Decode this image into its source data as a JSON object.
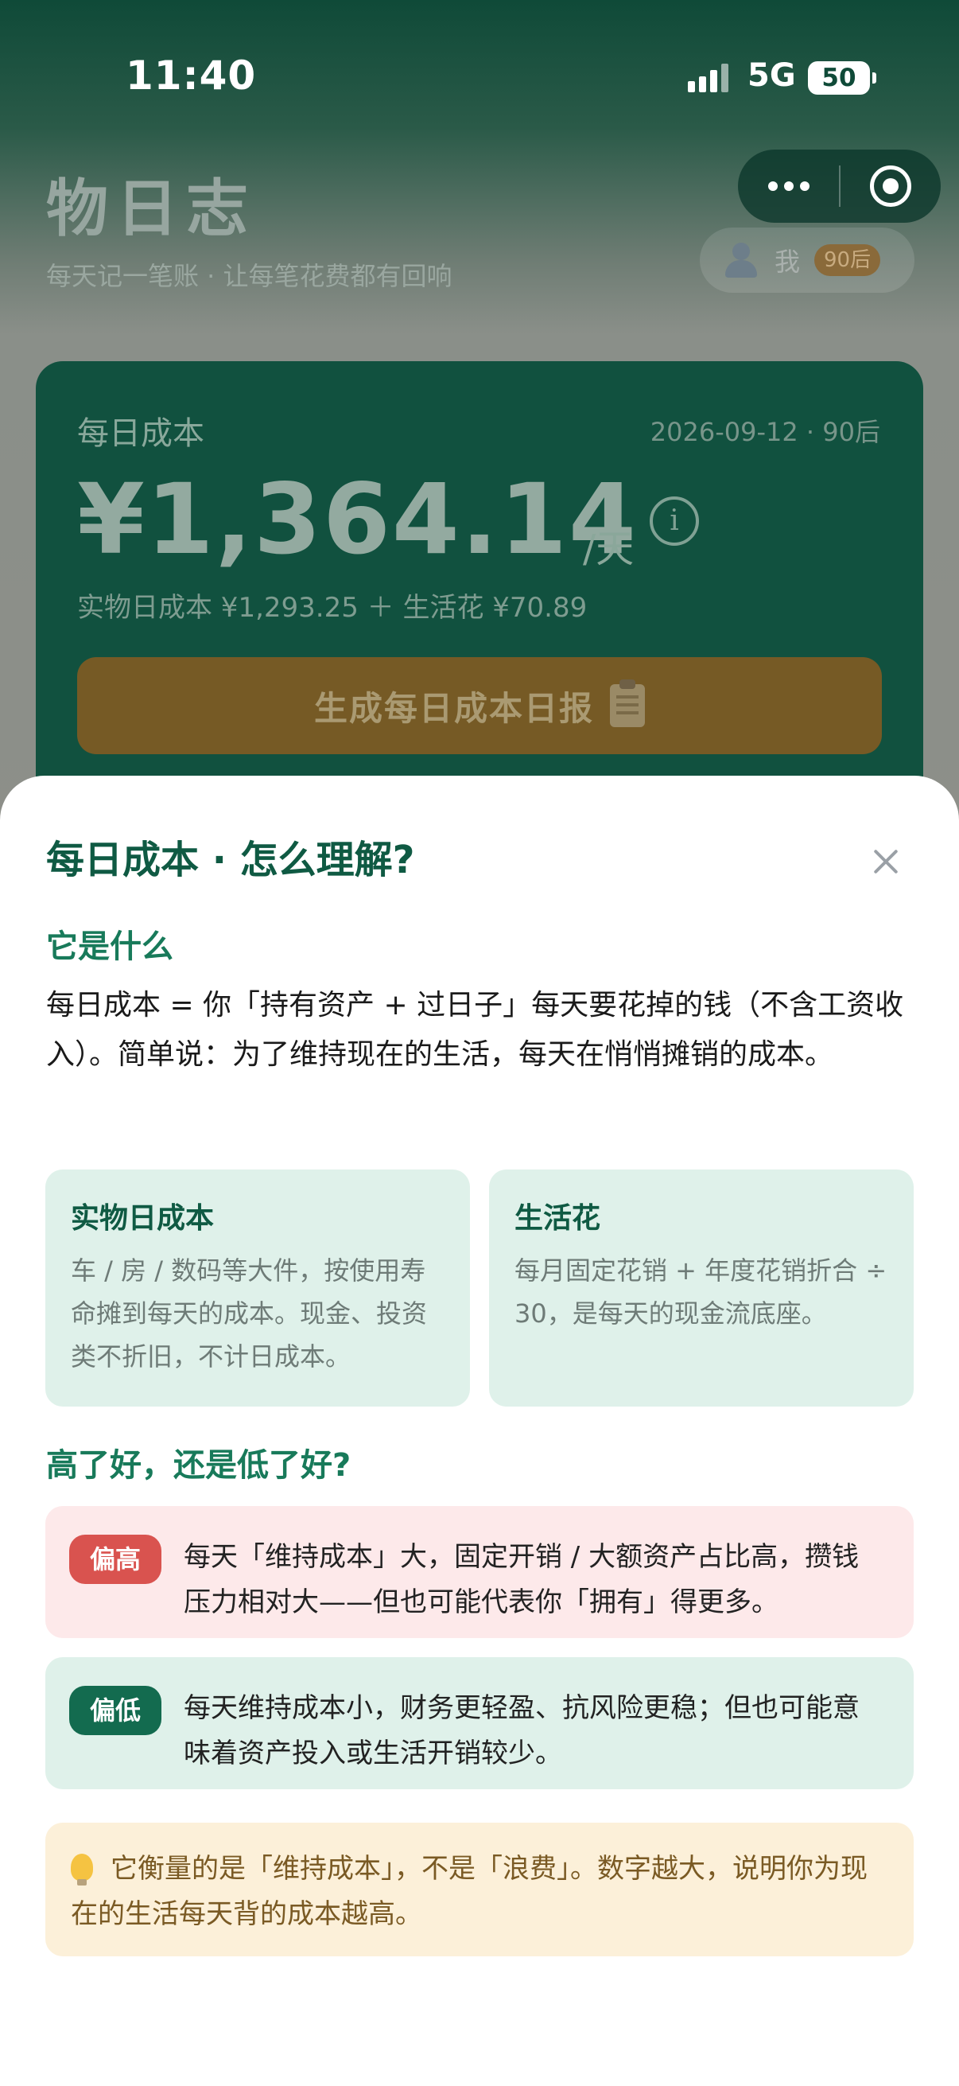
{
  "status_bar": {
    "time": "11:40",
    "network": "5G",
    "battery": "50"
  },
  "header": {
    "title": "物日志",
    "subtitle": "每天记一笔账 · 让每笔花费都有回响",
    "user_name": "我",
    "user_tag": "90后"
  },
  "cost_card": {
    "label": "每日成本",
    "date": "2026-09-12 · 90后",
    "amount": "¥1,364.14",
    "unit": "/天",
    "info_glyph": "i",
    "breakdown": "实物日成本 ¥1,293.25 ＋ 生活花 ¥70.89",
    "button_label": "生成每日成本日报"
  },
  "sheet": {
    "title": "每日成本 · 怎么理解?",
    "section_what": "它是什么",
    "definition": "每日成本 = 你「持有资产 + 过日子」每天要花掉的钱（不含工资收入）。简单说：为了维持现在的生活，每天在悄悄摊销的成本。",
    "box_physical": {
      "title": "实物日成本",
      "text": "车 / 房 / 数码等大件，按使用寿命摊到每天的成本。现金、投资类不折旧，不计日成本。"
    },
    "box_living": {
      "title": "生活花",
      "text": "每月固定花销 + 年度花销折合 ÷ 30，是每天的现金流底座。"
    },
    "section_good": "高了好，还是低了好?",
    "high": {
      "tag": "偏高",
      "text": "每天「维持成本」大，固定开销 / 大额资产占比高，攒钱压力相对大——但也可能代表你「拥有」得更多。"
    },
    "low": {
      "tag": "偏低",
      "text": "每天维持成本小，财务更轻盈、抗风险更稳；但也可能意味着资产投入或生活开销较少。"
    },
    "tip": "它衡量的是「维持成本」，不是「浪费」。数字越大，说明你为现在的生活每天背的成本越高。"
  },
  "colors": {
    "brand_green": "#0f5a43",
    "high_tag": "#d9534f",
    "low_tag": "#136b4f",
    "tip_bg": "#fcf0d9"
  }
}
